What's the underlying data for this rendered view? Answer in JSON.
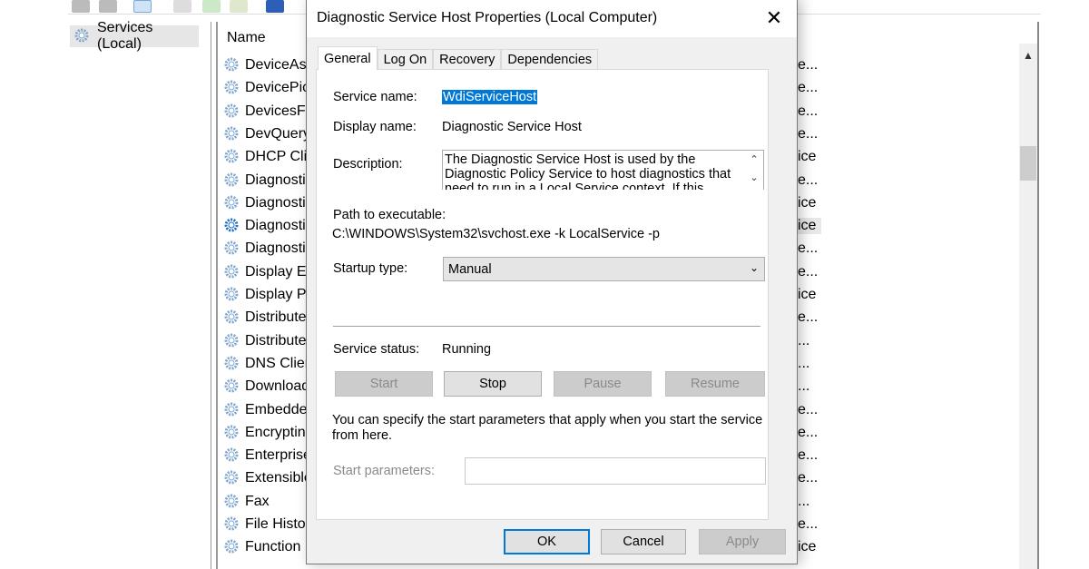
{
  "tree": {
    "root": "Services (Local)"
  },
  "list": {
    "header": {
      "name": "Name"
    },
    "rows": [
      {
        "name": "DeviceAss",
        "tail": "e..."
      },
      {
        "name": "DevicePic",
        "tail": "e..."
      },
      {
        "name": "DevicesFl",
        "tail": "e..."
      },
      {
        "name": "DevQuery",
        "tail": "e..."
      },
      {
        "name": "DHCP Cli",
        "tail": "ice"
      },
      {
        "name": "Diagnosti",
        "tail": "e..."
      },
      {
        "name": "Diagnosti",
        "tail": "ice"
      },
      {
        "name": "Diagnosti",
        "tail": "ice",
        "selected": true
      },
      {
        "name": "Diagnosti",
        "tail": "e..."
      },
      {
        "name": "Display Er",
        "tail": "e..."
      },
      {
        "name": "Display Po",
        "tail": "ice"
      },
      {
        "name": "Distribute",
        "tail": "e..."
      },
      {
        "name": "Distribute",
        "tail": "..."
      },
      {
        "name": "DNS Clier",
        "tail": "..."
      },
      {
        "name": "Download",
        "tail": "..."
      },
      {
        "name": "Embedde",
        "tail": "e..."
      },
      {
        "name": "Encryptin",
        "tail": "e..."
      },
      {
        "name": "Enterprise",
        "tail": "e..."
      },
      {
        "name": "Extensible",
        "tail": "e..."
      },
      {
        "name": "Fax",
        "tail": "..."
      },
      {
        "name": "File Histo",
        "tail": "e..."
      },
      {
        "name": "Function",
        "tail": "ice"
      }
    ]
  },
  "dialog": {
    "title": "Diagnostic Service Host Properties (Local Computer)",
    "close": "✕",
    "tabs": [
      "General",
      "Log On",
      "Recovery",
      "Dependencies"
    ],
    "active_tab": "General",
    "service_name_label": "Service name:",
    "service_name": "WdiServiceHost",
    "display_name_label": "Display name:",
    "display_name": "Diagnostic Service Host",
    "description_label": "Description:",
    "description": "The Diagnostic Service Host is used by the Diagnostic Policy Service to host diagnostics that need to run in a Local Service context.  If this",
    "path_label": "Path to executable:",
    "path": "C:\\WINDOWS\\System32\\svchost.exe -k LocalService -p",
    "startup_label": "Startup type:",
    "startup_value": "Manual",
    "status_label": "Service status:",
    "status_value": "Running",
    "buttons": {
      "start": "Start",
      "stop": "Stop",
      "pause": "Pause",
      "resume": "Resume"
    },
    "params_hint": "You can specify the start parameters that apply when you start the service from here.",
    "params_label": "Start parameters:",
    "params_value": "",
    "footer": {
      "ok": "OK",
      "cancel": "Cancel",
      "apply": "Apply"
    }
  },
  "colors": {
    "selection": "#0078d7",
    "gear": "#5a8fc4"
  }
}
